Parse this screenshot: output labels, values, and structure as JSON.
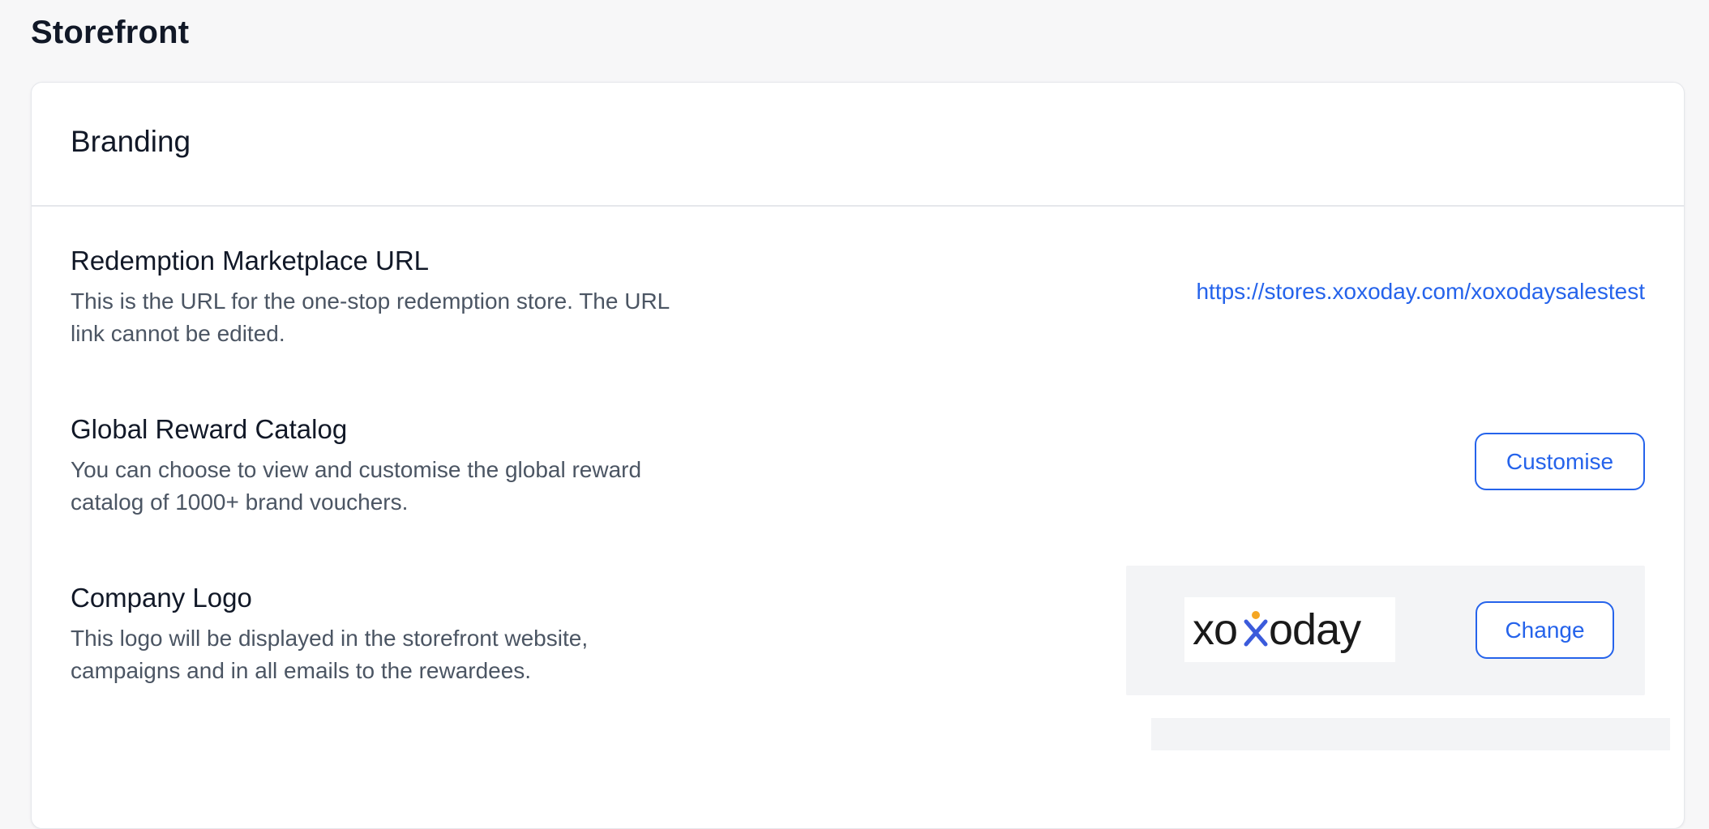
{
  "page": {
    "title": "Storefront"
  },
  "card": {
    "title": "Branding"
  },
  "redemption_url": {
    "title": "Redemption Marketplace URL",
    "description": "This is the URL for the one-stop redemption store. The URL link cannot be edited.",
    "link_text": "https://stores.xoxoday.com/xoxodaysalestest"
  },
  "global_catalog": {
    "title": "Global Reward Catalog",
    "description": "You can choose to view and customise the global reward catalog of 1000+ brand vouchers.",
    "button_label": "Customise"
  },
  "company_logo": {
    "title": "Company Logo",
    "description": "This logo will be displayed in the storefront website, campaigns and in all emails to the rewardees.",
    "logo_text": "xoxoday",
    "button_label": "Change"
  },
  "colors": {
    "accent": "#2563eb",
    "text_primary": "#111827",
    "text_secondary": "#4b5563",
    "panel_bg": "#f3f4f6",
    "logo_orange": "#f5a623",
    "logo_blue": "#3b5bdb"
  }
}
